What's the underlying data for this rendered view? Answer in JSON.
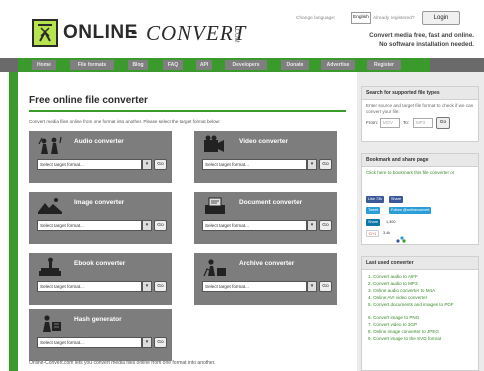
{
  "header": {
    "logo_online": "ONLINE",
    "logo_dash": "-",
    "logo_convert": "CONVERT",
    "logo_com": ".COM",
    "change_language_label": "Change language:",
    "language_value": "English",
    "already_registered": "Already registered?",
    "login_label": "Login",
    "tagline_line1": "Convert media free, fast and online.",
    "tagline_line2": "No software installation needed."
  },
  "nav": {
    "items": [
      "Home",
      "File formats",
      "Blog",
      "FAQ",
      "API",
      "Developers",
      "Donate",
      "Advertise",
      "Register"
    ]
  },
  "main": {
    "title": "Free online file converter",
    "intro": "Convert media files online from one format into another. Please select the target format below:",
    "select_placeholder": "Select target format...",
    "select_arrow": "▾",
    "go_label": "Go",
    "converters": [
      {
        "title": "Audio converter",
        "icon": "audio-icon"
      },
      {
        "title": "Video converter",
        "icon": "video-icon"
      },
      {
        "title": "Image converter",
        "icon": "image-icon"
      },
      {
        "title": "Document converter",
        "icon": "document-icon"
      },
      {
        "title": "Ebook converter",
        "icon": "ebook-icon"
      },
      {
        "title": "Archive converter",
        "icon": "archive-icon"
      },
      {
        "title": "Hash generator",
        "icon": "hash-icon"
      }
    ],
    "footer": "Online-Convert.com lets you convert media files online from one format into another."
  },
  "sidebar": {
    "search": {
      "title": "Search for supported file types",
      "text": "Enter source and target file format to check if we can convert your file:",
      "from_label": "From:",
      "from_placeholder": "MOV",
      "to_label": "To:",
      "to_placeholder": "MP3",
      "go_label": "Go"
    },
    "bookmark": {
      "title": "Bookmark and share page",
      "text": "Click here to bookmark this file converter or",
      "like_label": "Like",
      "like_count": "73k",
      "share_label": "Share",
      "tweet_label": "Tweet",
      "follow_label": "Follow @onlineconvert",
      "in_share_label": "Share",
      "in_share_count": "1,300",
      "gplus_label": "G+1",
      "gplus_count": "3.4k"
    },
    "last_used": {
      "title": "Last used converter",
      "items": [
        "1. Convert audio to AIFF",
        "2. Convert audio to MP3",
        "3. Online audio converter to M4A",
        "4. Online AVI video converter",
        "5. Convert documents and images to PDF",
        "6. Convert image to PNG",
        "7. Convert video to 3GP",
        "8. Online image converter to JPEG",
        "9. Convert image to the SVG format"
      ]
    }
  },
  "colors": {
    "brand_green": "#3a9a2c",
    "logo_lime": "#b7e34d",
    "card_gray": "#7d7d7d",
    "nav_gray": "#7f7f7f"
  }
}
